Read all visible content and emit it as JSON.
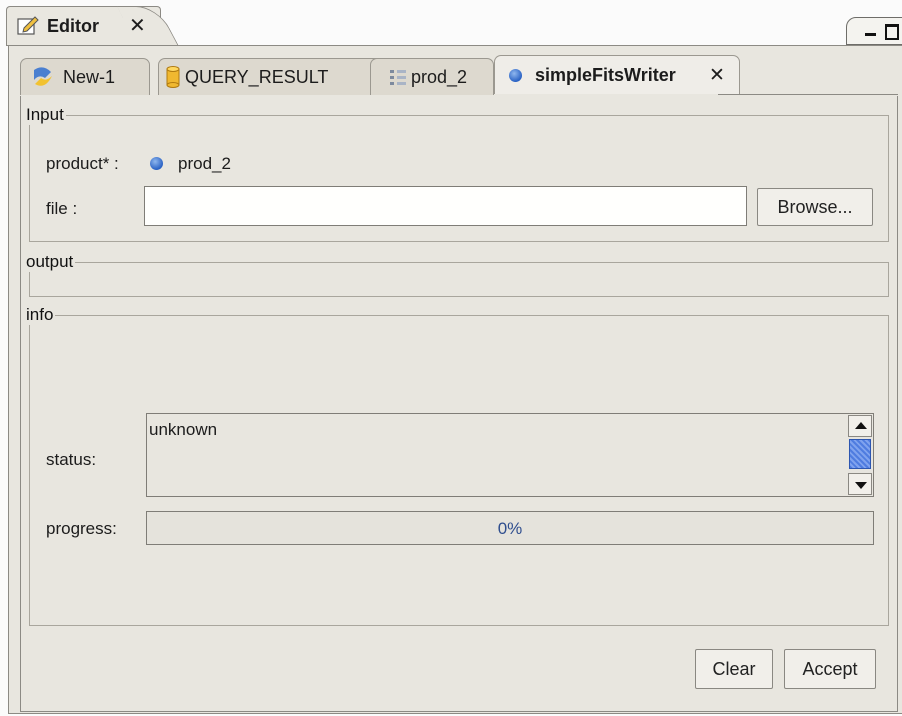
{
  "editor": {
    "title": "Editor",
    "close_glyph": "✕",
    "icon": "edit-icon"
  },
  "window_controls": {
    "minimize_icon": "minimize-icon",
    "maximize_icon": "maximize-icon"
  },
  "tabs": [
    {
      "label": "New-1",
      "icon": "script-icon",
      "active": false
    },
    {
      "label": "QUERY_RESULT",
      "icon": "cylinder-icon",
      "active": false
    },
    {
      "label": "prod_2",
      "icon": "tree-icon",
      "active": false
    },
    {
      "label": "simpleFitsWriter",
      "icon": "blue-dot-icon",
      "active": true,
      "close_glyph": "✕"
    }
  ],
  "input_group": {
    "legend": "Input",
    "product_label": "product* :",
    "product_value": "prod_2",
    "file_label": "file :",
    "file_value": "",
    "browse_label": "Browse..."
  },
  "output_group": {
    "legend": "output"
  },
  "info_group": {
    "legend": "info",
    "status_label": "status:",
    "status_text": "unknown",
    "progress_label": "progress:",
    "progress_percent": 0,
    "progress_text": "0%"
  },
  "actions": {
    "clear_label": "Clear",
    "accept_label": "Accept"
  },
  "colors": {
    "panel": "#e8e6df",
    "accent": "#2a62c4",
    "progress_text": "#2f4e8e"
  }
}
